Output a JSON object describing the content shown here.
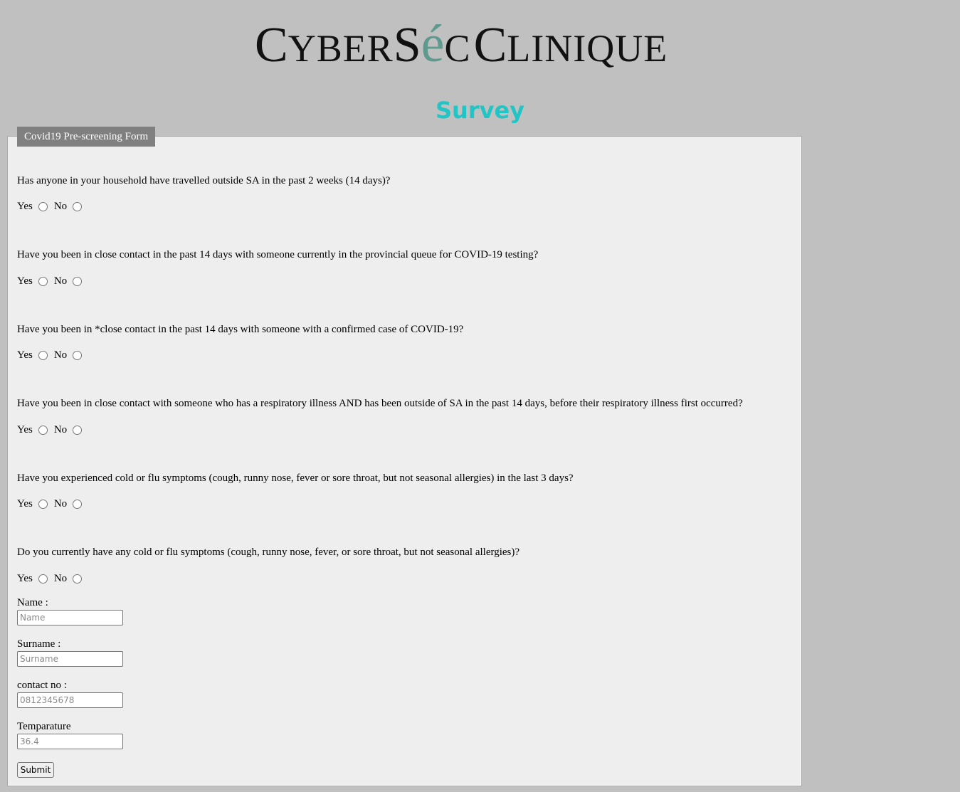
{
  "header": {
    "logo_parts": [
      "C",
      "YBER",
      "S",
      "é",
      "C",
      "C",
      "LINIQUE"
    ],
    "logo_text": "CyberSéc Clinique",
    "accent_color": "#5e9a8d",
    "title": "Survey",
    "title_color": "#22c5c5"
  },
  "form": {
    "legend": "Covid19 Pre-screening Form",
    "yes_label": "Yes",
    "no_label": "No",
    "questions": [
      {
        "text": "Has anyone in your household have travelled outside SA in the past 2 weeks (14 days)?"
      },
      {
        "text": "Have you been in close contact in the past 14 days with someone currently in the provincial queue for COVID-19 testing?"
      },
      {
        "text": "Have you been in *close contact in the past 14 days with someone with a confirmed case of COVID-19?"
      },
      {
        "text": "Have you been in close contact with someone who has a respiratory illness AND has been outside of SA in the past 14 days, before their respiratory illness first occurred?"
      },
      {
        "text": "Have you experienced cold or flu symptoms (cough, runny nose, fever or sore throat, but not seasonal allergies) in the last 3 days?"
      },
      {
        "text": "Do you currently have any cold or flu symptoms (cough, runny nose, fever, or sore throat, but not seasonal allergies)?"
      }
    ],
    "fields": {
      "name": {
        "label": "Name :",
        "placeholder": "Name"
      },
      "surname": {
        "label": "Surname :",
        "placeholder": "Surname"
      },
      "contact": {
        "label": "contact no :",
        "placeholder": "0812345678"
      },
      "temperature": {
        "label": "Temparature",
        "placeholder": "36.4"
      }
    },
    "submit_label": "Submit"
  }
}
